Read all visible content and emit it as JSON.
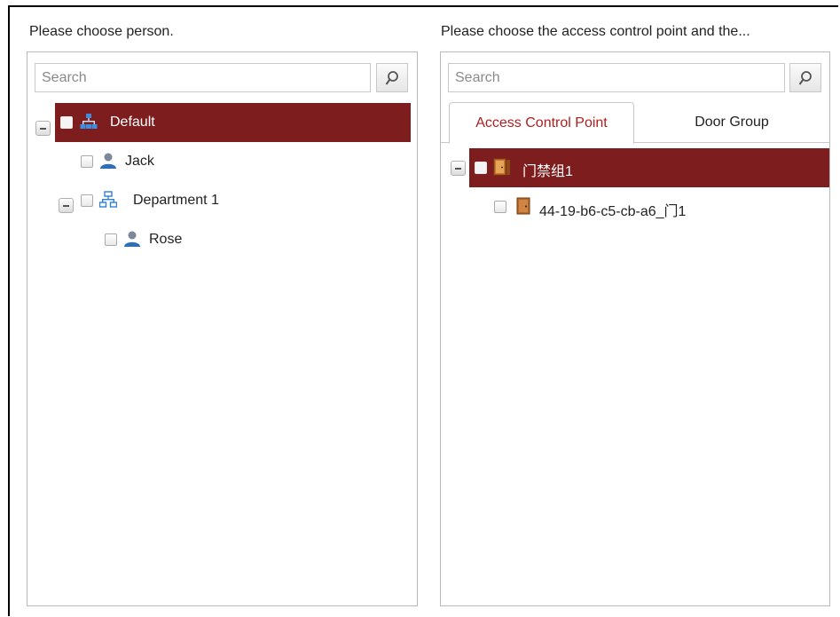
{
  "left": {
    "title": "Please choose person.",
    "search_placeholder": "Search",
    "tree": {
      "root": "Default",
      "jack": "Jack",
      "department": "Department 1",
      "rose": "Rose"
    }
  },
  "right": {
    "title": "Please choose the access control point and the...",
    "search_placeholder": "Search",
    "tabs": [
      "Access Control Point",
      "Door Group"
    ],
    "tree": {
      "group": "门禁组1",
      "door": "44-19-b6-c5-cb-a6_门1"
    }
  },
  "colors": {
    "selected_row": "#7e1d1d",
    "active_tab_text": "#b01e1e",
    "group_icon": "#2f7fd6",
    "person_icon": "#2e6fb5",
    "door_icon": "#b5692a"
  }
}
